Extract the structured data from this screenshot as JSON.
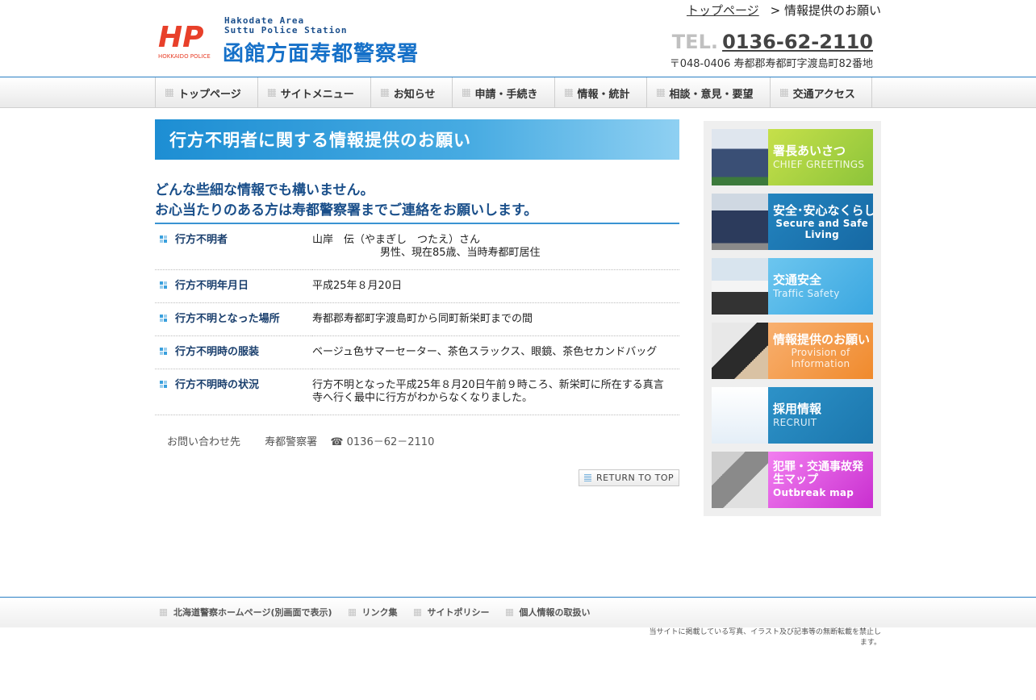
{
  "header": {
    "logo": {
      "mark_text": "HP",
      "mark_sub": "HOKKAIDO POLICE",
      "en_line1": "Hakodate Area",
      "en_line2": "Suttu Police Station",
      "ja_name": "函館方面寿都警察署"
    },
    "breadcrumb": {
      "home": "トップページ",
      "current": "> 情報提供のお願い"
    },
    "tel_label": "TEL.",
    "tel_number": "0136-62-2110",
    "address": "〒048-0406 寿都郡寿都町字渡島町82番地"
  },
  "nav": {
    "items": [
      {
        "label": "トップページ"
      },
      {
        "label": "サイトメニュー"
      },
      {
        "label": "お知らせ"
      },
      {
        "label": "申請・手続き"
      },
      {
        "label": "情報・統計"
      },
      {
        "label": "相談・意見・要望"
      },
      {
        "label": "交通アクセス"
      }
    ]
  },
  "main": {
    "title": "行方不明者に関する情報提供のお願い",
    "lead_line1": "どんな些細な情報でも構いません。",
    "lead_line2": "お心当たりのある方は寿都警察署までご連絡をお願いします。",
    "rows": [
      {
        "key": "行方不明者",
        "value": "山岸　伝（やまぎし　つたえ）さん",
        "value2": "男性、現在85歳、当時寿都町居住"
      },
      {
        "key": "行方不明年月日",
        "value": "平成25年８月20日",
        "value2": ""
      },
      {
        "key": "行方不明となった場所",
        "value": "寿都郡寿都町字渡島町から同町新栄町までの間",
        "value2": ""
      },
      {
        "key": "行方不明時の服装",
        "value": "ベージュ色サマーセーター、茶色スラックス、眼鏡、茶色セカンドバッグ",
        "value2": ""
      },
      {
        "key": "行方不明時の状況",
        "value": "行方不明となった平成25年８月20日午前９時ころ、新栄町に所在する真言寺へ行く最中に行方がわからなくなりました。",
        "value2": ""
      }
    ],
    "contact_label": "お問い合わせ先",
    "contact_org": "寿都警察署",
    "contact_phone": "☎ 0136－62－2110",
    "return_top": "RETURN TO TOP"
  },
  "side": {
    "banners": [
      {
        "title": "署長あいさつ",
        "sub": "CHIEF GREETINGS",
        "color_from": "#c6e04a",
        "color_to": "#8cc43a"
      },
      {
        "title": "安全･安心なくらし",
        "sub": "Secure and Safe Living",
        "color_from": "#2384bf",
        "color_to": "#1668a3"
      },
      {
        "title": "交通安全",
        "sub": "Traffic Safety",
        "color_from": "#6cc6ef",
        "color_to": "#3aa6e0"
      },
      {
        "title": "情報提供のお願い",
        "sub": "Provision of Information",
        "color_from": "#f8b070",
        "color_to": "#f08a2c"
      },
      {
        "title": "採用情報",
        "sub": "RECRUIT",
        "color_from": "#2d92c8",
        "color_to": "#1b76ad"
      },
      {
        "title": "犯罪・交通事故発生マップ",
        "sub": "Outbreak map",
        "color_from": "#f27ff0",
        "color_to": "#c92fd0"
      }
    ]
  },
  "footer": {
    "links": [
      {
        "label": "北海道警察ホームページ(別画面で表示)"
      },
      {
        "label": "リンク集"
      },
      {
        "label": "サイトポリシー"
      },
      {
        "label": "個人情報の取扱い"
      }
    ],
    "copyright": "当サイトに掲載している写真、イラスト及び記事等の無断転載を禁止します。"
  },
  "colors": {
    "accent_blue": "#2a7fc4",
    "title_gradient_start": "#1d8ed3",
    "heading_navy": "#1a4f8a"
  }
}
